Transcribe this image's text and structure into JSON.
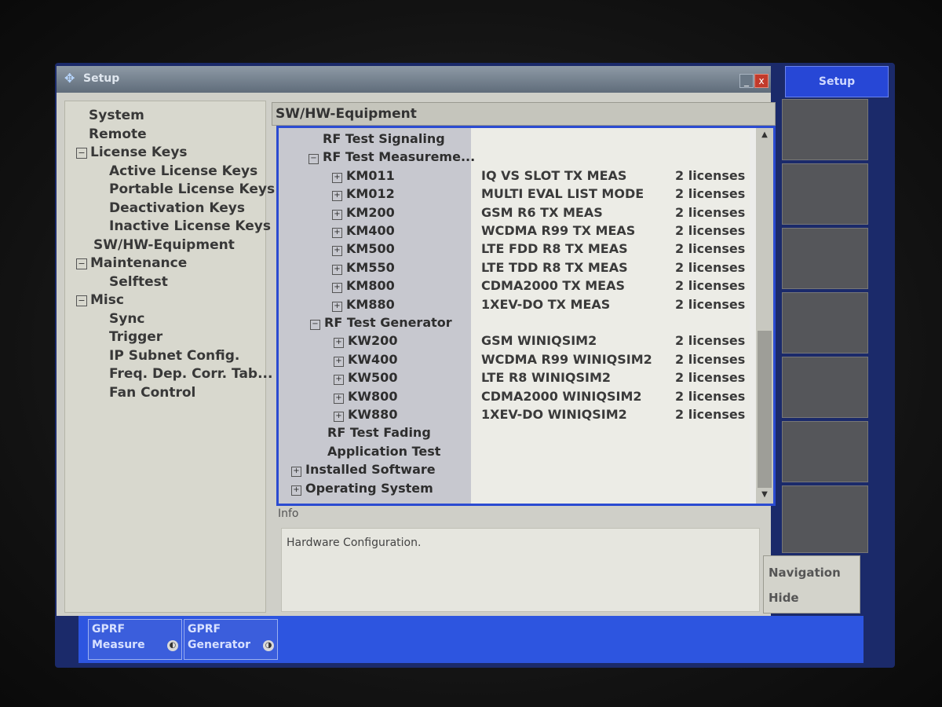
{
  "window": {
    "title": "Setup",
    "min_label": "_",
    "close_label": "x",
    "icon": "setup-gear-icon"
  },
  "left_tree": [
    {
      "label": "System",
      "expander": ""
    },
    {
      "label": "Remote",
      "expander": ""
    },
    {
      "label": "License Keys",
      "expander": "−"
    },
    {
      "label": "Active License Keys",
      "expander": ""
    },
    {
      "label": "Portable License Keys",
      "expander": ""
    },
    {
      "label": "Deactivation Keys",
      "expander": ""
    },
    {
      "label": "Inactive License Keys",
      "expander": ""
    },
    {
      "label": "SW/HW-Equipment",
      "expander": ""
    },
    {
      "label": "Maintenance",
      "expander": "−"
    },
    {
      "label": "Selftest",
      "expander": ""
    },
    {
      "label": "Misc",
      "expander": "−"
    },
    {
      "label": "Sync",
      "expander": ""
    },
    {
      "label": "Trigger",
      "expander": ""
    },
    {
      "label": "IP Subnet Config.",
      "expander": ""
    },
    {
      "label": "Freq. Dep. Corr. Tab...",
      "expander": ""
    },
    {
      "label": "Fan Control",
      "expander": ""
    }
  ],
  "panel": {
    "title": "SW/HW-Equipment"
  },
  "tree": [
    {
      "label": "RF Test Signaling",
      "desc": "",
      "licenses": "",
      "expander": ""
    },
    {
      "label": "RF Test Measureme...",
      "desc": "",
      "licenses": "",
      "expander": "−"
    },
    {
      "label": "KM011",
      "desc": "IQ VS SLOT TX MEAS",
      "licenses": "2 licenses",
      "expander": "+"
    },
    {
      "label": "KM012",
      "desc": "MULTI EVAL LIST MODE",
      "licenses": "2 licenses",
      "expander": "+"
    },
    {
      "label": "KM200",
      "desc": "GSM R6 TX MEAS",
      "licenses": "2 licenses",
      "expander": "+"
    },
    {
      "label": "KM400",
      "desc": "WCDMA R99 TX MEAS",
      "licenses": "2 licenses",
      "expander": "+"
    },
    {
      "label": "KM500",
      "desc": "LTE FDD R8 TX MEAS",
      "licenses": "2 licenses",
      "expander": "+"
    },
    {
      "label": "KM550",
      "desc": "LTE TDD R8 TX MEAS",
      "licenses": "2 licenses",
      "expander": "+"
    },
    {
      "label": "KM800",
      "desc": "CDMA2000 TX MEAS",
      "licenses": "2 licenses",
      "expander": "+"
    },
    {
      "label": "KM880",
      "desc": "1XEV-DO TX MEAS",
      "licenses": "2 licenses",
      "expander": "+"
    },
    {
      "label": "RF Test Generator",
      "desc": "",
      "licenses": "",
      "expander": "−"
    },
    {
      "label": "KW200",
      "desc": "GSM WINIQSIM2",
      "licenses": "2 licenses",
      "expander": "+"
    },
    {
      "label": "KW400",
      "desc": "WCDMA R99 WINIQSIM2",
      "licenses": "2 licenses",
      "expander": "+"
    },
    {
      "label": "KW500",
      "desc": "LTE R8 WINIQSIM2",
      "licenses": "2 licenses",
      "expander": "+"
    },
    {
      "label": "KW800",
      "desc": "CDMA2000 WINIQSIM2",
      "licenses": "2 licenses",
      "expander": "+"
    },
    {
      "label": "KW880",
      "desc": "1XEV-DO WINIQSIM2",
      "licenses": "2 licenses",
      "expander": "+"
    },
    {
      "label": "RF Test Fading",
      "desc": "",
      "licenses": "",
      "expander": ""
    },
    {
      "label": "Application Test",
      "desc": "",
      "licenses": "",
      "expander": ""
    },
    {
      "label": "Installed Software",
      "desc": "",
      "licenses": "",
      "expander": "+"
    },
    {
      "label": "Operating System",
      "desc": "",
      "licenses": "",
      "expander": "+"
    }
  ],
  "info": {
    "label": "Info",
    "text": "Hardware Configuration."
  },
  "softkeys": {
    "setup": "Setup",
    "navigation": "Navigation",
    "hide": "Hide"
  },
  "bottom_buttons": [
    {
      "line1": "GPRF",
      "line2": "Measure",
      "icon": "measure-icon"
    },
    {
      "line1": "GPRF",
      "line2": "Generator",
      "icon": "generator-icon"
    }
  ],
  "colors": {
    "accent": "#2b4bd1",
    "softkey_blue": "#2747d6"
  }
}
